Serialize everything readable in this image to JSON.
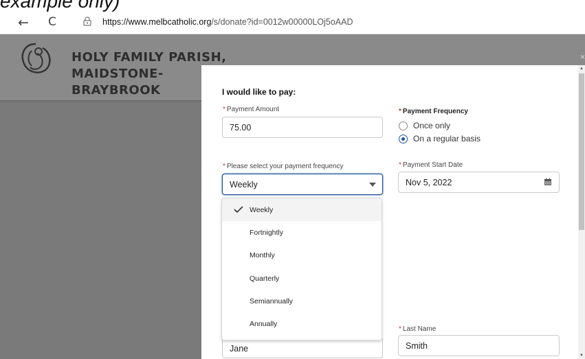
{
  "caption": "example only)",
  "browser": {
    "back_glyph": "←",
    "reload_glyph": "C",
    "url_host": "https://www.melbcatholic.org",
    "url_path": "/s/donate?id=0012w00000LOj5oAAD"
  },
  "header": {
    "parish_name": "HOLY FAMILY PARISH, MAIDSTONE-BRAYBROOK",
    "close_glyph": "×"
  },
  "form": {
    "section_title": "I would like to pay:",
    "payment_amount_label": "Payment Amount",
    "payment_amount_value": "75.00",
    "payment_frequency_label": "Payment Frequency",
    "frequency_options": [
      "Once only",
      "On a regular basis"
    ],
    "frequency_selected": "On a regular basis",
    "select_frequency_label": "Please select your payment frequency",
    "select_frequency_value": "Weekly",
    "start_date_label": "Payment Start Date",
    "start_date_value": "Nov 5, 2022",
    "last_name_label": "Last Name",
    "first_name_value": "Jane",
    "last_name_value": "Smith",
    "required_marker": "*"
  },
  "dropdown": {
    "options": [
      "Weekly",
      "Fortnightly",
      "Monthly",
      "Quarterly",
      "Semiannually",
      "Annually"
    ],
    "selected": "Weekly"
  },
  "colors": {
    "accent": "#1b5297",
    "required": "#c23934",
    "overlay": "#7a7a7a"
  }
}
